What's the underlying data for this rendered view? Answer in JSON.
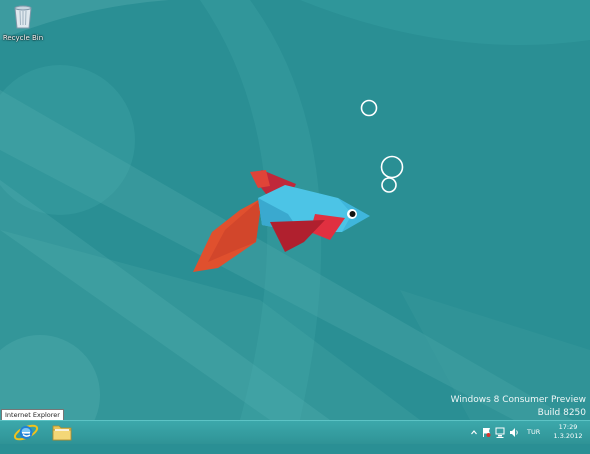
{
  "desktop": {
    "icons": [
      {
        "label": "Recycle Bin",
        "icon": "recycle-bin-icon"
      }
    ],
    "watermark": {
      "edition": "Windows 8 Consumer Preview",
      "build": "Build 8250"
    },
    "wallpaper": {
      "subject": "fish",
      "background": "#2a8f94"
    }
  },
  "tooltip": {
    "text": "Internet Explorer"
  },
  "taskbar": {
    "pinned": [
      {
        "name": "Internet Explorer",
        "icon": "internet-explorer-icon"
      },
      {
        "name": "File Explorer",
        "icon": "folder-icon"
      }
    ],
    "tray": {
      "language": "TUR",
      "time": "17:29",
      "date": "1.3.2012"
    }
  },
  "colors": {
    "taskbar": "#3ca8ab",
    "fish_body": "#4cc4e6",
    "fish_fin": "#c0283a",
    "fish_tail": "#e0502e"
  }
}
